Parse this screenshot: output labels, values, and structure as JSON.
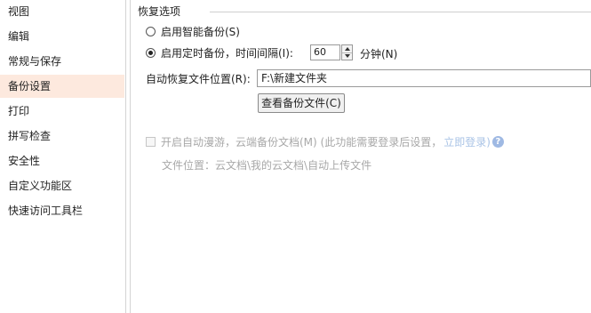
{
  "sidebar": {
    "items": [
      {
        "label": "视图"
      },
      {
        "label": "编辑"
      },
      {
        "label": "常规与保存"
      },
      {
        "label": "备份设置"
      },
      {
        "label": "打印"
      },
      {
        "label": "拼写检查"
      },
      {
        "label": "安全性"
      },
      {
        "label": "自定义功能区"
      },
      {
        "label": "快速访问工具栏"
      }
    ],
    "active_index": 3
  },
  "restore": {
    "group_title": "恢复选项",
    "smart_backup_label": "启用智能备份(S)",
    "timed_backup_label": "启用定时备份，时间间隔(I):",
    "interval_value": "60",
    "interval_unit": "分钟(N)",
    "location_label": "自动恢复文件位置(R):",
    "location_value": "F:\\新建文件夹",
    "view_button_label": "查看备份文件(C)"
  },
  "cloud": {
    "roaming_label": "开启自动漫游，云端备份文档(M) (此功能需要登录后设置，",
    "login_link": "立即登录)",
    "help_glyph": "?",
    "path_text": "文件位置：云文档\\我的云文档\\自动上传文件"
  },
  "colors": {
    "active_sidebar_bg": "#fde9de",
    "link": "#a9c3e6",
    "disabled_text": "#a8a8a8"
  }
}
